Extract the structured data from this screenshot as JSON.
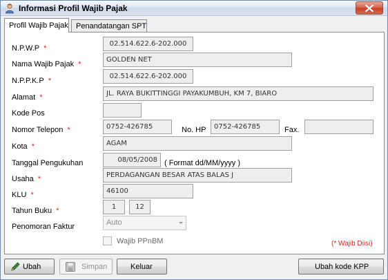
{
  "window": {
    "title": "Informasi Profil Wajib Pajak"
  },
  "tabs": [
    {
      "label": "Profil Wajib Pajak"
    },
    {
      "label": "Penandatangan SPT"
    }
  ],
  "required_mark": "*",
  "form": {
    "npwp": {
      "label": "N.P.W.P",
      "value": "02.514.622.6-202.000"
    },
    "nama": {
      "label": "Nama Wajib Pajak",
      "value": "GOLDEN NET"
    },
    "nppkp": {
      "label": "N.P.P.K.P",
      "value": "02.514.622.6-202.000"
    },
    "alamat": {
      "label": "Alamat",
      "value": "JL. RAYA BUKITTINGGI PAYAKUMBUH, KM 7, BIARO"
    },
    "kode_pos": {
      "label": "Kode Pos",
      "value": ""
    },
    "telepon": {
      "label": "Nomor Telepon",
      "value": "0752-426785"
    },
    "hp": {
      "label": "No. HP",
      "value": "0752-426785"
    },
    "fax": {
      "label": "Fax.",
      "value": ""
    },
    "kota": {
      "label": "Kota",
      "value": "AGAM"
    },
    "tanggal": {
      "label": "Tanggal Pengukuhan",
      "value": "08/05/2008",
      "hint": "( Format dd/MM/yyyy )"
    },
    "usaha": {
      "label": "Usaha",
      "value": "PERDAGANGAN BESAR ATAS BALAS J"
    },
    "klu": {
      "label": "KLU",
      "value": "46100"
    },
    "tahun_buku": {
      "label": "Tahun Buku",
      "from": "1",
      "to": "12"
    },
    "penomoran": {
      "label": "Penomoran Faktur",
      "value": "Auto"
    },
    "wajib_ppnbm": {
      "label": "Wajib PPnBM",
      "checked": false
    }
  },
  "required_note": "(* Wajib Diisi)",
  "buttons": {
    "ubah": "Ubah",
    "simpan": "Simpan",
    "keluar": "Keluar",
    "ubah_kpp": "Ubah kode KPP"
  },
  "colors": {
    "required": "#e02020",
    "title_bar": "#dde6f2",
    "close_button": "#c7402a"
  }
}
